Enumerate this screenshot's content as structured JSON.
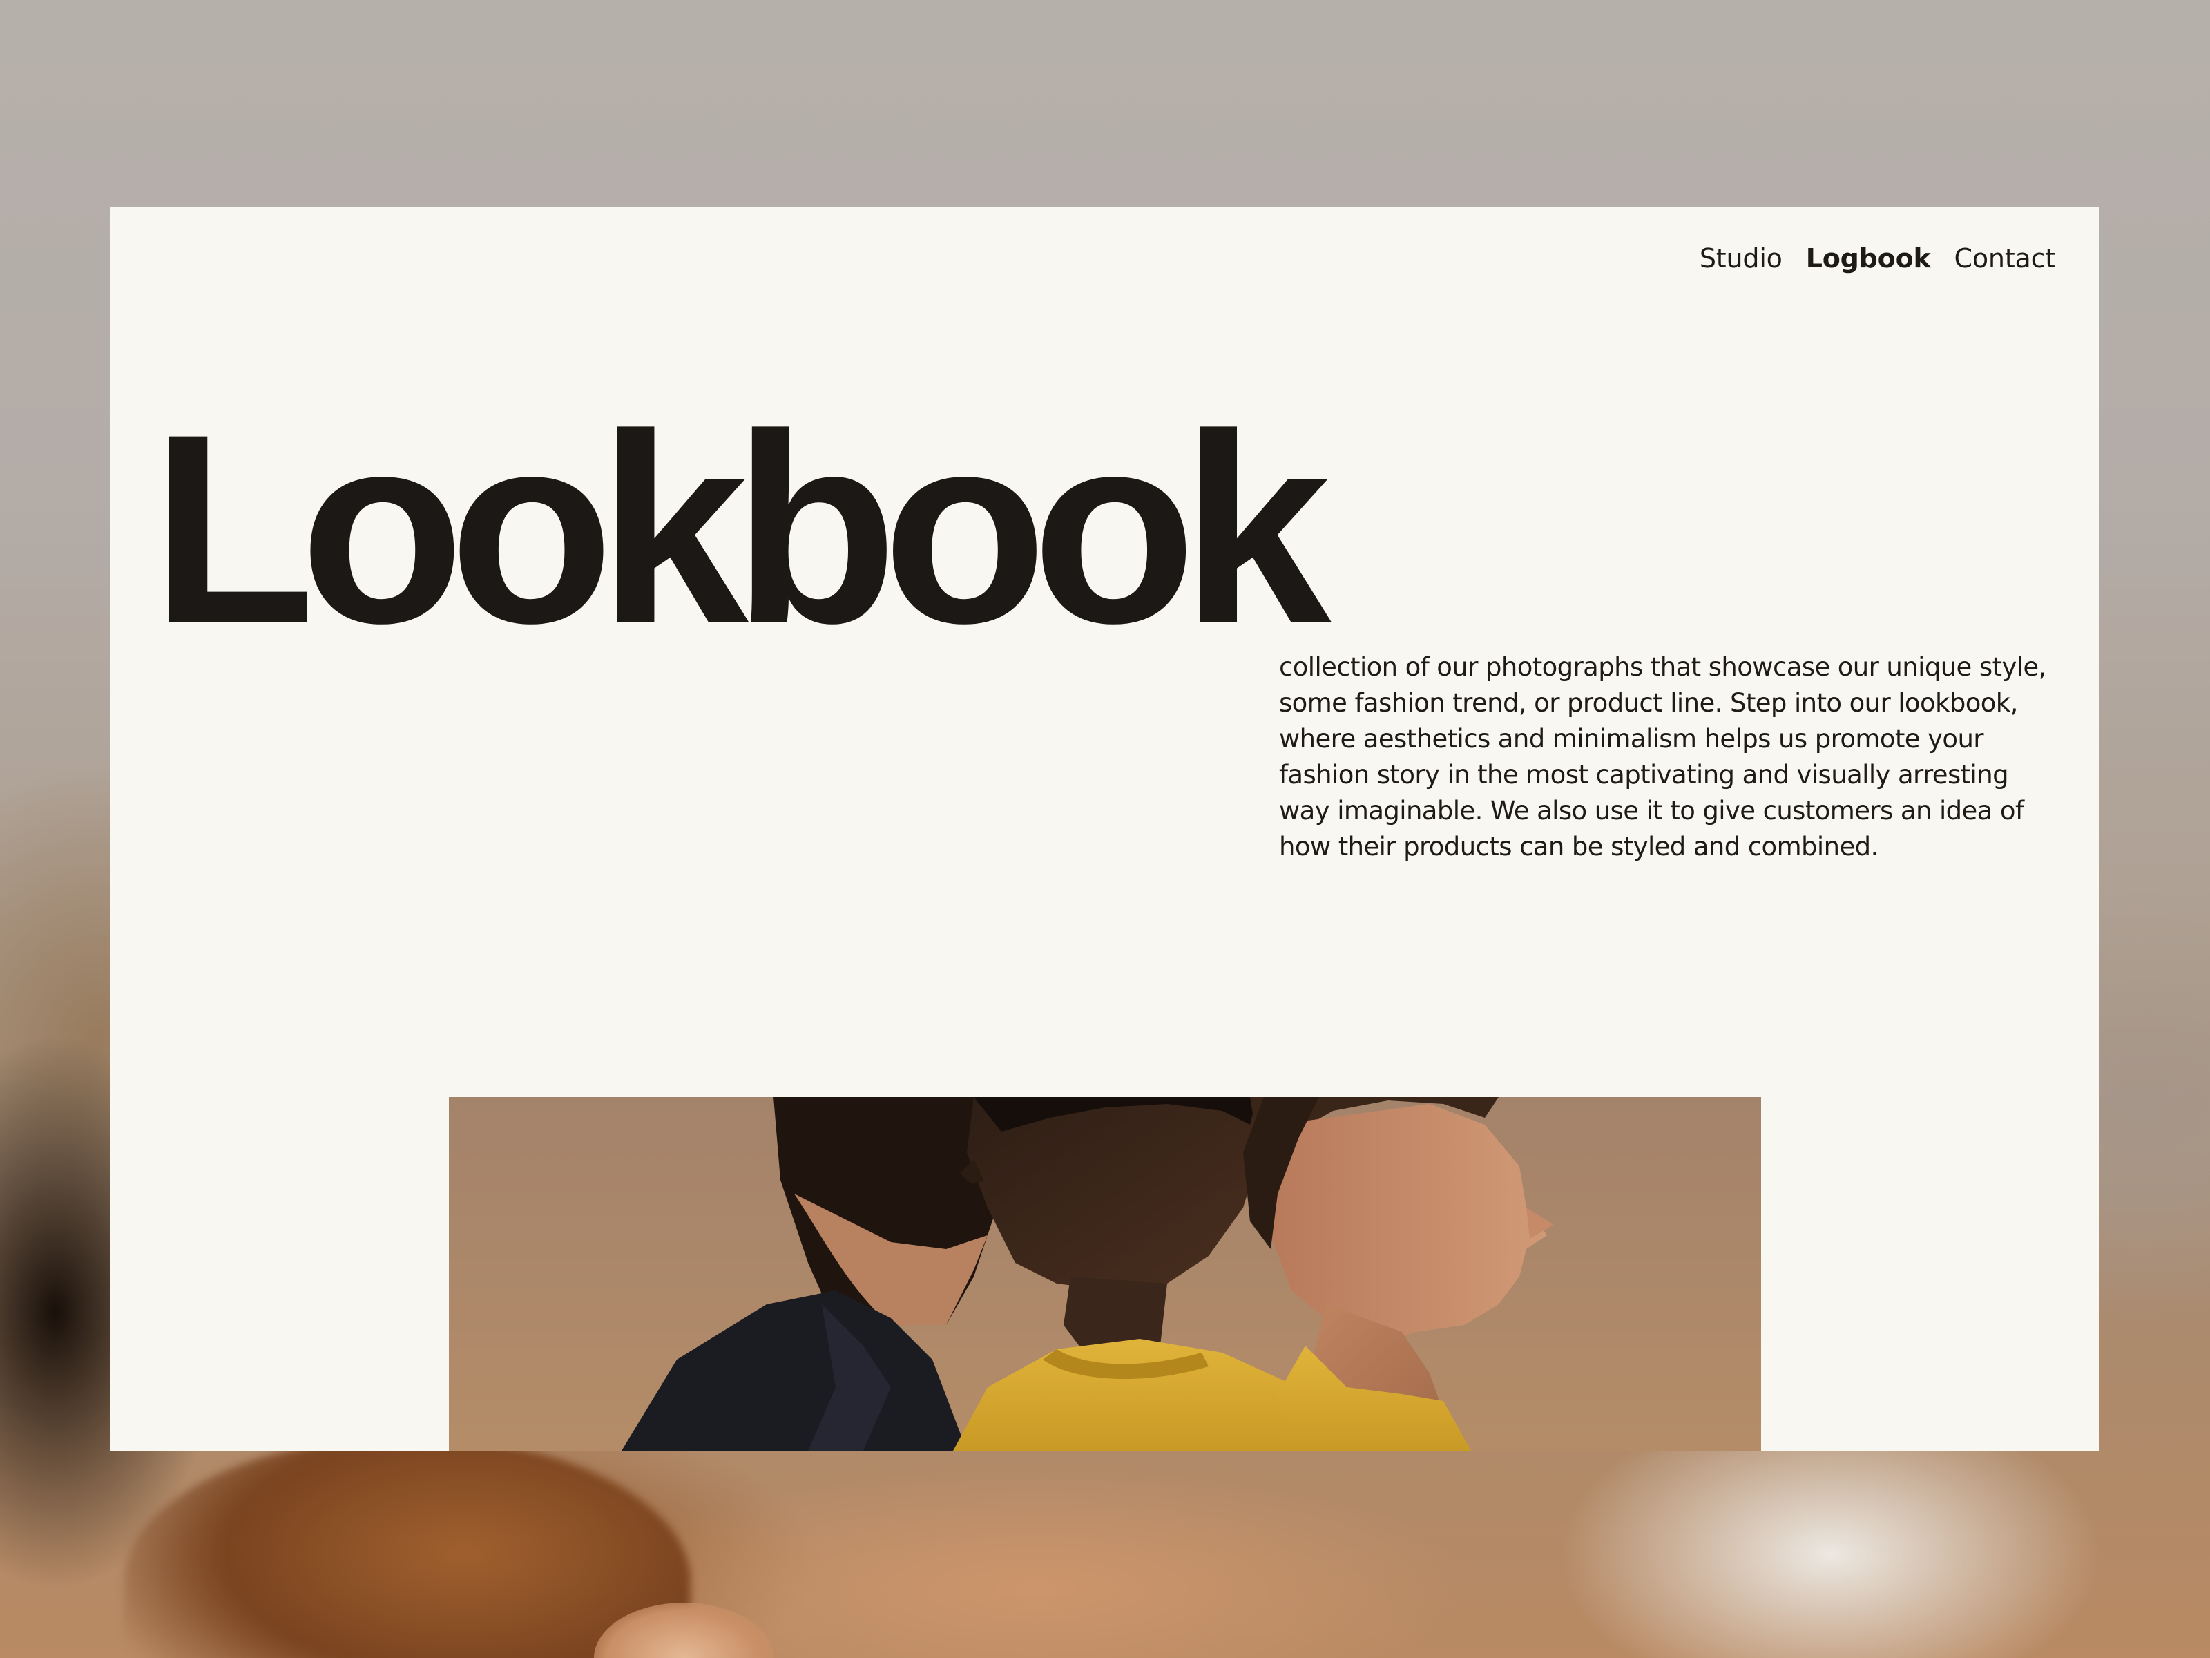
{
  "nav": {
    "items": [
      {
        "label": "Studio",
        "active": false
      },
      {
        "label": "Logbook",
        "active": true
      },
      {
        "label": "Contact",
        "active": false
      }
    ]
  },
  "hero": {
    "title": "Lookbook"
  },
  "intro": {
    "text": "collection of our photographs that showcase our unique style, some fashion trend, or product line. Step into our lookbook, where aesthetics and minimalism helps us promote your fashion story in the most captivating and visually arresting way imaginable. We also use it to give customers an idea of how their products can be styled and combined."
  },
  "colors": {
    "card_background": "#f9f7f2",
    "text": "#1c1816",
    "page_background": "#b7b0a9"
  }
}
